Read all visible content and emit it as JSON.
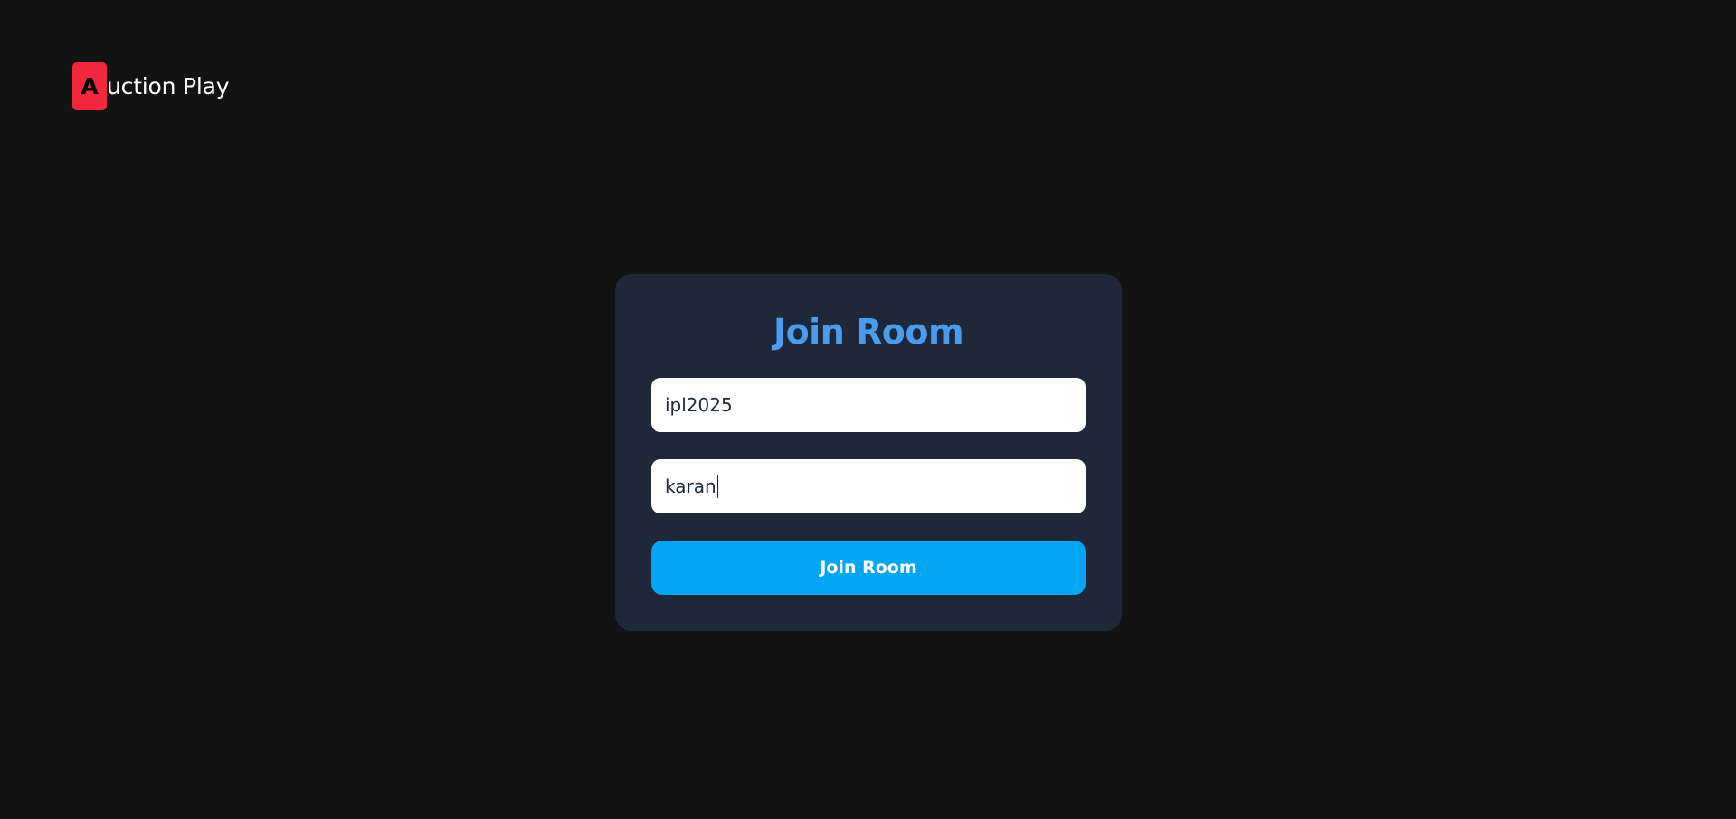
{
  "brand": {
    "mark_letter": "A",
    "name_rest": "uction Play",
    "mark_color": "#f1283b"
  },
  "join_form": {
    "title": "Join Room",
    "room_code_value": "ipl2025",
    "player_name_value": "karan",
    "submit_label": "Join Room"
  },
  "colors": {
    "background": "#131313",
    "card": "#1e2838",
    "title_accent": "#4a9cee",
    "button": "#02a6f2"
  }
}
